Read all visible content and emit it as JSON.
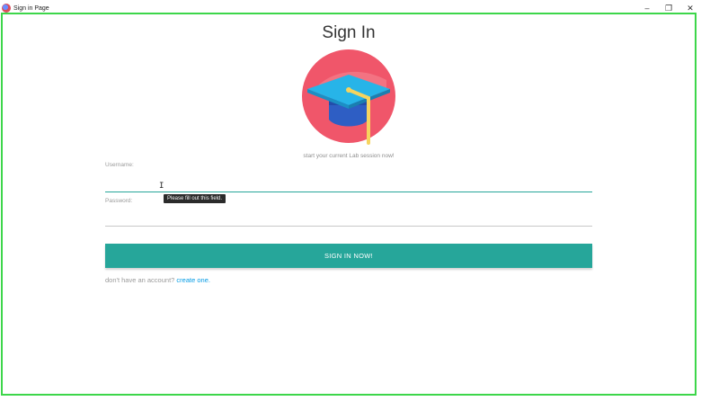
{
  "window": {
    "title": "Sign in Page",
    "controls": {
      "minimize": "–",
      "maximize": "❐",
      "close": "✕"
    }
  },
  "form": {
    "heading": "Sign In",
    "logo_icon": "graduation-cap-icon",
    "tagline": "start your current Lab session now!",
    "username": {
      "label": "Username:",
      "value": "",
      "placeholder": "",
      "focused": true
    },
    "password": {
      "label": "Password:",
      "value": "",
      "placeholder": ""
    },
    "validation_tooltip": "Please fill out this field.",
    "submit_label": "SIGN IN NOW!",
    "signup_prompt": "don't have an account?",
    "signup_link": "create one."
  },
  "colors": {
    "accent": "#26a69a",
    "link": "#039be5",
    "frame_highlight": "#3dd64a",
    "logo_circle": "#f0566a"
  }
}
